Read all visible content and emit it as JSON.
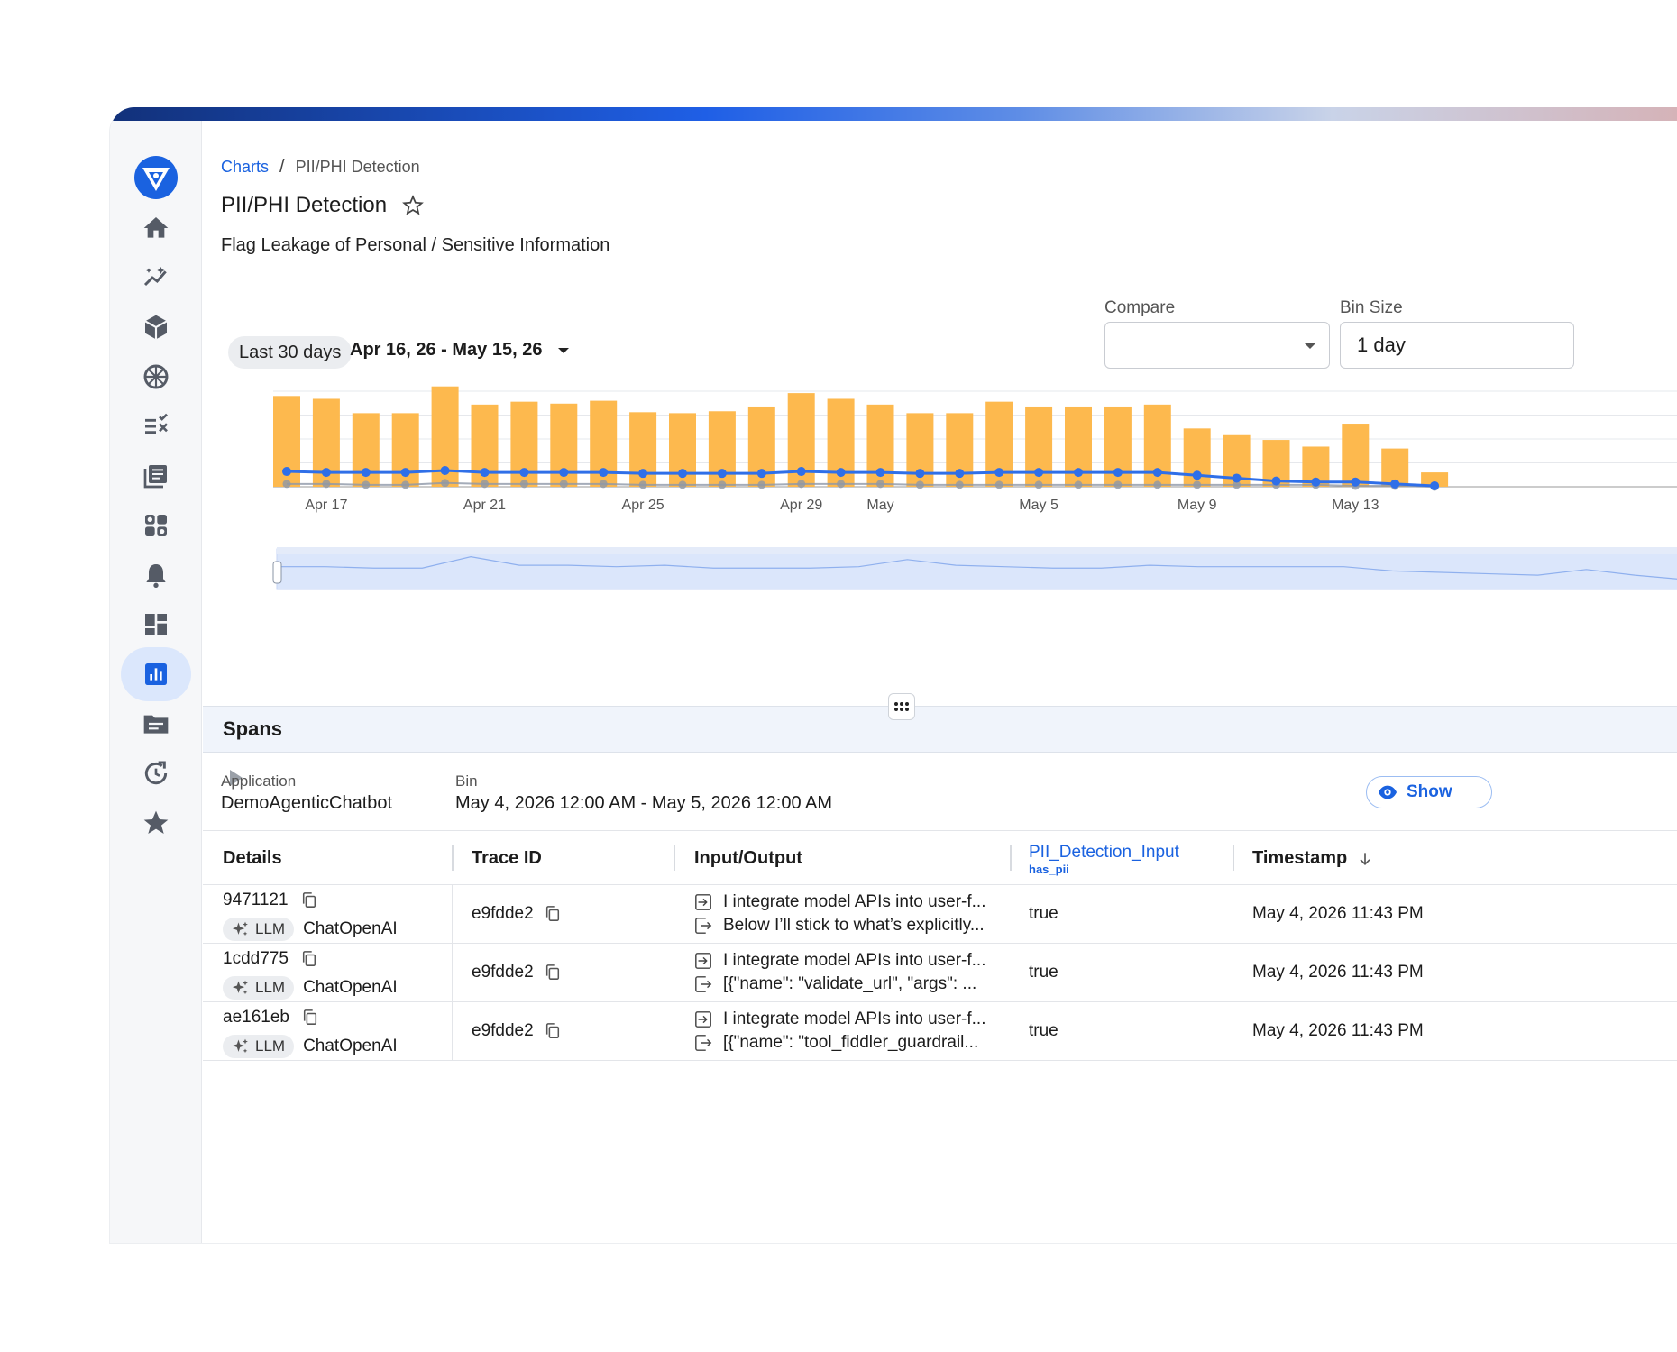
{
  "sidebar": {
    "items": [
      {
        "icon": "home-icon"
      },
      {
        "icon": "trending-icon"
      },
      {
        "icon": "cube-icon"
      },
      {
        "icon": "brain-icon"
      },
      {
        "icon": "checklist-icon"
      },
      {
        "icon": "documents-icon"
      },
      {
        "icon": "grid-icon"
      },
      {
        "icon": "bell-icon"
      },
      {
        "icon": "dashboard-icon"
      },
      {
        "icon": "bar-chart-icon",
        "active": true
      },
      {
        "icon": "folder-icon"
      },
      {
        "icon": "history-icon"
      },
      {
        "icon": "star-icon"
      }
    ]
  },
  "breadcrumb": {
    "root": "Charts",
    "separator": "/",
    "current": "PII/PHI Detection"
  },
  "header": {
    "title": "PII/PHI Detection",
    "subtitle": "Flag Leakage of Personal / Sensitive Information"
  },
  "controls": {
    "range_preset": "Last 30 days",
    "range_text": "Apr 16, 26 - May 15, 26",
    "compare_label": "Compare",
    "compare_value": "",
    "bin_label": "Bin Size",
    "bin_value": "1 day"
  },
  "chart_data": {
    "type": "bar",
    "x": [
      "Apr 16",
      "Apr 17",
      "Apr 18",
      "Apr 19",
      "Apr 20",
      "Apr 21",
      "Apr 22",
      "Apr 23",
      "Apr 24",
      "Apr 25",
      "Apr 26",
      "Apr 27",
      "Apr 28",
      "Apr 29",
      "Apr 30",
      "May 1",
      "May 2",
      "May 3",
      "May 4",
      "May 5",
      "May 6",
      "May 7",
      "May 8",
      "May 9",
      "May 10",
      "May 11",
      "May 12",
      "May 13",
      "May 14",
      "May 15"
    ],
    "tick_labels": [
      "Apr 17",
      "Apr 21",
      "Apr 25",
      "Apr 29",
      "May",
      "May 5",
      "May 9",
      "May 13"
    ],
    "series": [
      {
        "type": "bar",
        "color": "#fdb94e",
        "values": [
          95,
          92,
          77,
          77,
          105,
          86,
          89,
          87,
          90,
          78,
          77,
          79,
          84,
          98,
          92,
          86,
          77,
          77,
          89,
          84,
          84,
          84,
          86,
          61,
          54,
          49,
          42,
          66,
          40,
          15
        ]
      },
      {
        "type": "line",
        "color": "#2f6fe8",
        "values": [
          16,
          15,
          15,
          15,
          17,
          15,
          15,
          15,
          15,
          14,
          14,
          14,
          14,
          16,
          15,
          15,
          14,
          14,
          15,
          15,
          15,
          15,
          15,
          12,
          9,
          6,
          5,
          5,
          3,
          1
        ]
      },
      {
        "type": "line",
        "color": "#8d97a8",
        "values": [
          3,
          3,
          2,
          2,
          4,
          3,
          3,
          3,
          3,
          2,
          2,
          2,
          2,
          3,
          3,
          3,
          2,
          2,
          2,
          2,
          2,
          2,
          2,
          2,
          2,
          2,
          2,
          1,
          1,
          0
        ]
      }
    ],
    "overview_values": [
      11,
      11,
      10,
      10,
      18,
      12,
      12,
      11,
      12,
      10,
      10,
      10,
      11,
      16,
      12,
      11,
      10,
      10,
      12,
      11,
      11,
      11,
      11,
      8,
      7,
      6,
      5,
      9,
      5,
      2
    ],
    "grid": true
  },
  "spans": {
    "title": "Spans",
    "application_label": "Application",
    "application_value": "DemoAgenticChatbot",
    "bin_label": "Bin",
    "bin_value": "May 4, 2026 12:00 AM - May 5, 2026 12:00 AM",
    "show_button": "Show"
  },
  "table": {
    "headers": {
      "details": "Details",
      "trace_id": "Trace ID",
      "io": "Input/Output",
      "pii": "PII_Detection_Input",
      "pii_sub": "has_pii",
      "timestamp": "Timestamp"
    },
    "rows": [
      {
        "id": "9471121",
        "badge": "LLM",
        "model": "ChatOpenAI",
        "trace": "e9fdde2",
        "input": "I integrate model APIs into user-f...",
        "output": "Below I’ll stick to what’s explicitly...",
        "pii": "true",
        "timestamp": "May 4, 2026 11:43 PM"
      },
      {
        "id": "1cdd775",
        "badge": "LLM",
        "model": "ChatOpenAI",
        "trace": "e9fdde2",
        "input": "I integrate model APIs into user-f...",
        "output": "[{\"name\": \"validate_url\", \"args\": ...",
        "pii": "true",
        "timestamp": "May 4, 2026 11:43 PM"
      },
      {
        "id": "ae161eb",
        "badge": "LLM",
        "model": "ChatOpenAI",
        "trace": "e9fdde2",
        "input": "I integrate model APIs into user-f...",
        "output": "[{\"name\": \"tool_fiddler_guardrail...",
        "pii": "true",
        "timestamp": "May 4, 2026 11:43 PM"
      }
    ]
  }
}
